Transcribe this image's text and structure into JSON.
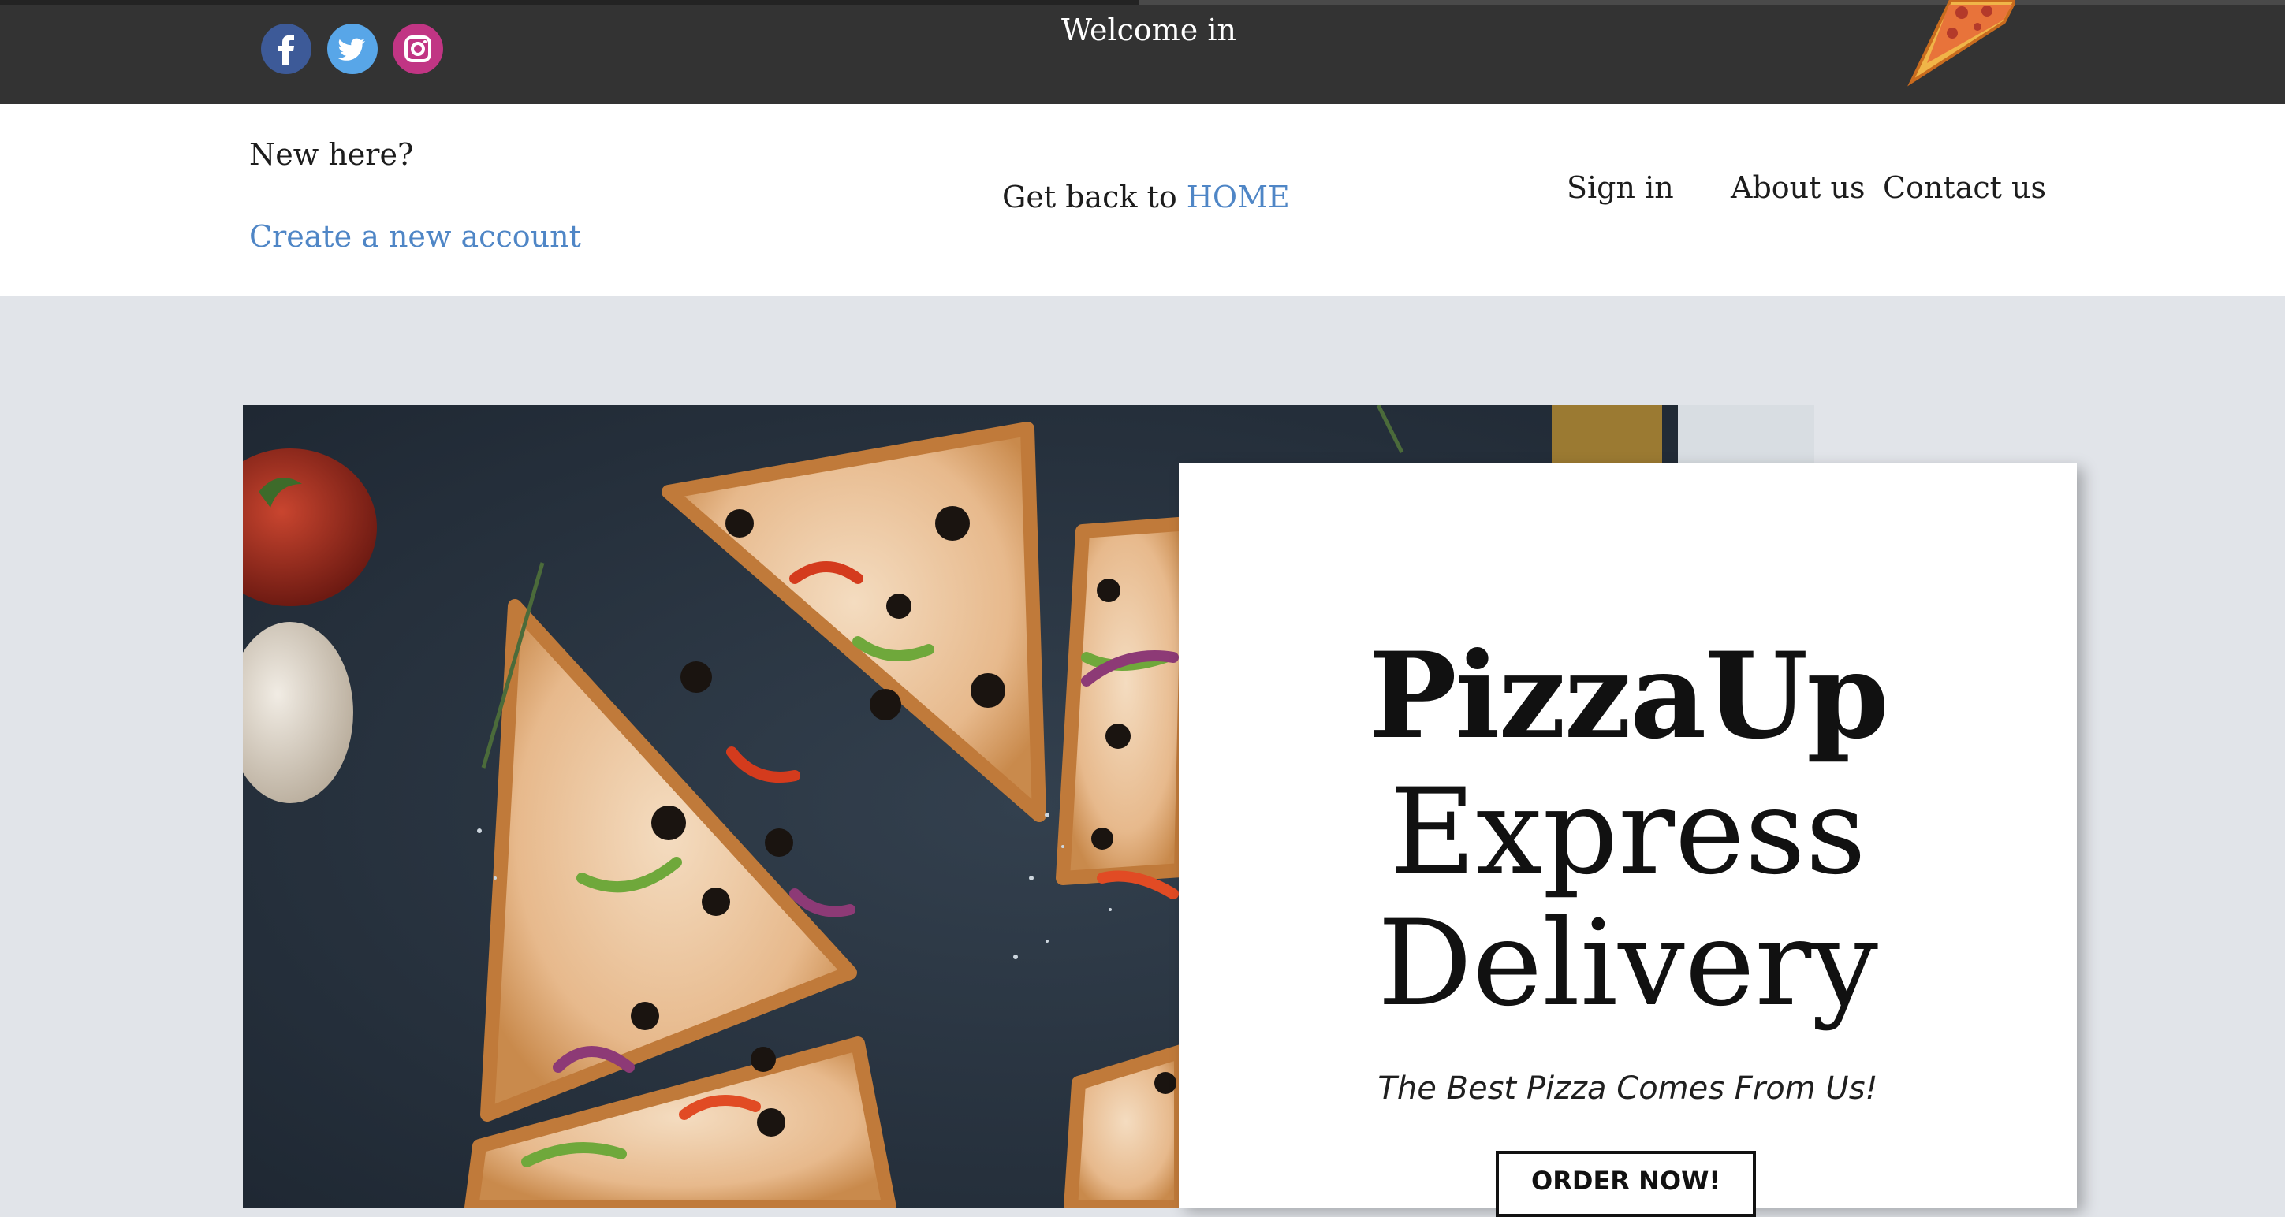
{
  "header": {
    "welcome_text": "Welcome in",
    "social": [
      {
        "name": "facebook-icon",
        "color": "#3d5a98"
      },
      {
        "name": "twitter-icon",
        "color": "#58a6e8"
      },
      {
        "name": "instagram-icon",
        "color": "#c13584"
      }
    ],
    "logo_icon": "pizza-slice-icon"
  },
  "nav": {
    "new_here": "New here?",
    "create_account": "Create a new account",
    "back_prefix": "Get back to ",
    "home_link": "HOME",
    "sign_in": "Sign in",
    "about_us": "About us",
    "contact_us": "Contact us",
    "link_color": "#4f86c6"
  },
  "hero": {
    "title_line1": "PizzaUp",
    "title_line2": "Express",
    "title_line3": "Delivery",
    "tagline": "The Best Pizza Comes From Us!",
    "cta": "ORDER NOW!"
  },
  "colors": {
    "topbar": "#333333",
    "page_bg": "#e1e4e9"
  }
}
